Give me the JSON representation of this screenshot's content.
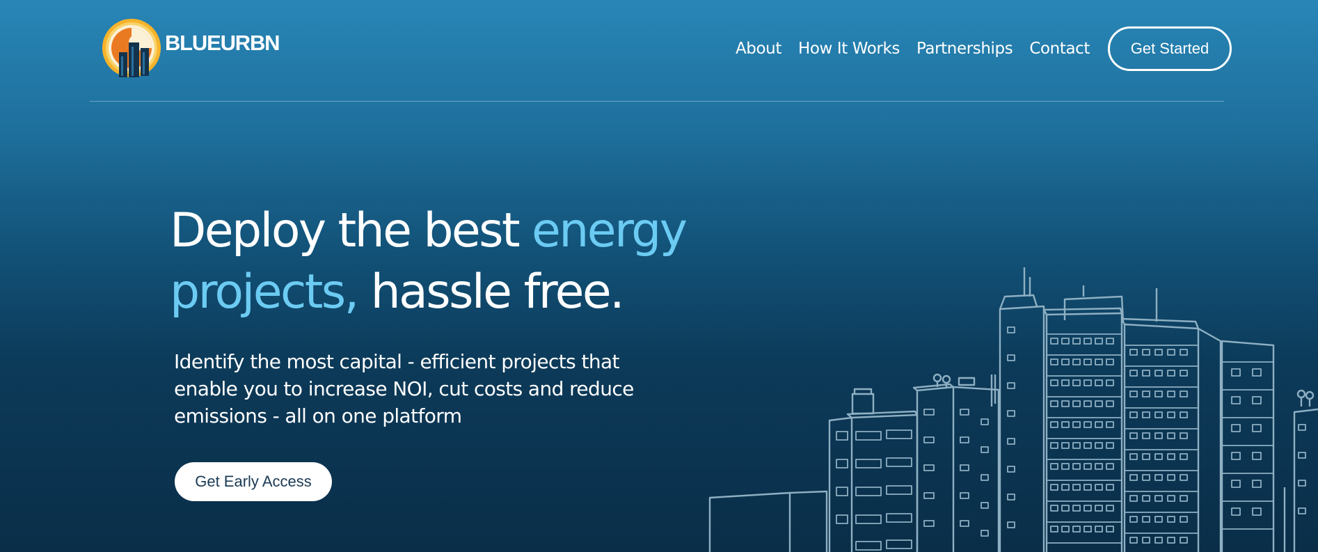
{
  "brand": {
    "name": "BLUEURBN",
    "logo_icon": "sun-building-logo-icon",
    "logo_colors": {
      "ring": "#f7b32b",
      "inner": "#ea7a22",
      "building": "#13334d"
    }
  },
  "nav": {
    "items": [
      {
        "label": "About"
      },
      {
        "label": "How It Works"
      },
      {
        "label": "Partnerships"
      },
      {
        "label": "Contact"
      }
    ],
    "cta_label": "Get Started"
  },
  "hero": {
    "title_part1": "Deploy the best ",
    "title_accent": "energy projects,",
    "title_part2": " hassle free.",
    "subtitle": "Identify the most capital - efficient projects that enable you to increase NOI, cut costs and reduce emissions - all on one platform",
    "cta_label": "Get Early Access"
  },
  "illustration": {
    "icon": "city-skyline-line-art-icon",
    "line_color": "#8fb0c3"
  },
  "colors": {
    "accent": "#6ccbf2",
    "background_top": "#2886b6",
    "background_bottom": "#0a2e48",
    "cta_text": "#1a3a55"
  }
}
